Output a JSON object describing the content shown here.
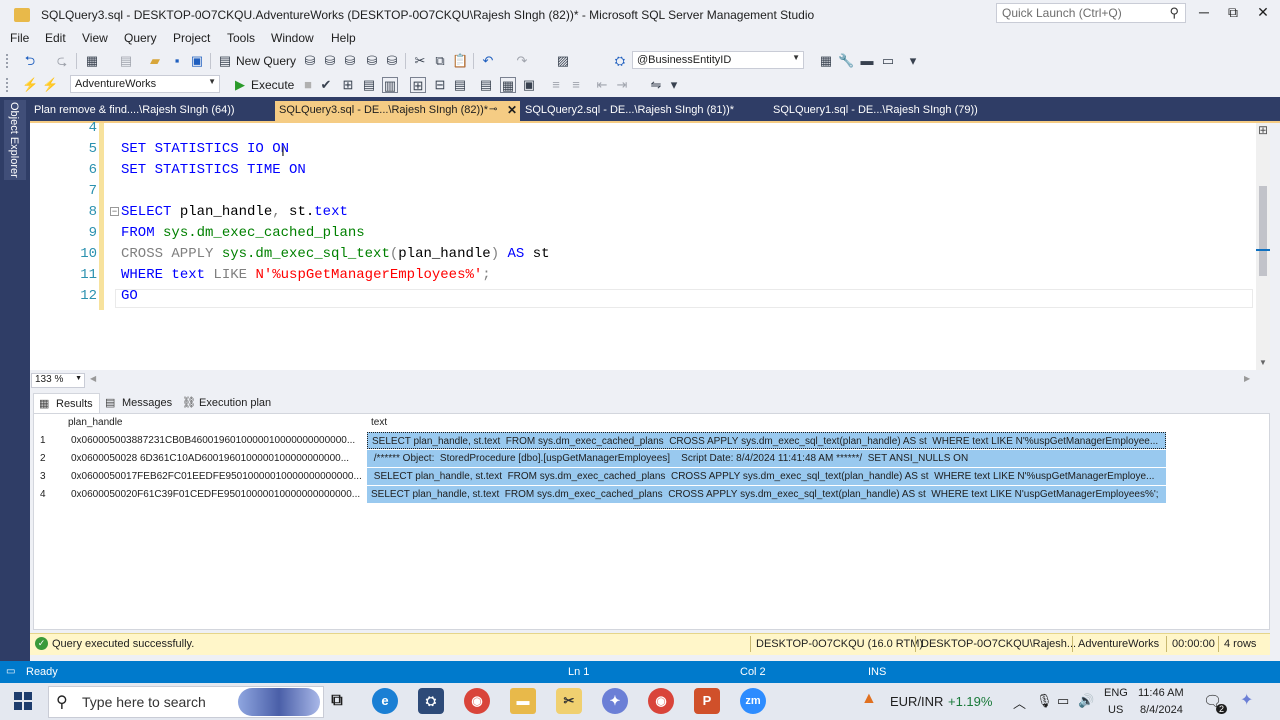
{
  "window": {
    "title": "SQLQuery3.sql - DESKTOP-0O7CKQU.AdventureWorks (DESKTOP-0O7CKQU\\Rajesh SIngh (82))* - Microsoft SQL Server Management Studio",
    "quick_launch_placeholder": "Quick Launch (Ctrl+Q)",
    "minimize": "─",
    "maximize": "⧉",
    "close": "✕"
  },
  "menu": [
    "File",
    "Edit",
    "View",
    "Query",
    "Project",
    "Tools",
    "Window",
    "Help"
  ],
  "toolbar": {
    "new_query_label": "New Query",
    "param_combo_value": "@BusinessEntityID",
    "database_combo_value": "AdventureWorks",
    "execute_label": "Execute"
  },
  "side": {
    "object_explorer_label": "Object Explorer"
  },
  "doc_tabs": [
    {
      "label": "Plan remove & find....\\Rajesh SIngh (64))"
    },
    {
      "label": "SQLQuery3.sql - DE...\\Rajesh SIngh (82))*"
    },
    {
      "label": "SQLQuery2.sql - DE...\\Rajesh SIngh (81))*"
    },
    {
      "label": "SQLQuery1.sql - DE...\\Rajesh SIngh (79))"
    }
  ],
  "editor": {
    "line_numbers": [
      "4",
      "5",
      "6",
      "7",
      "8",
      "9",
      "10",
      "11",
      "12"
    ],
    "code": {
      "l5_a": "SET STATISTICS IO ",
      "l5_b": "ON",
      "l6_a": "SET STATISTICS TIME ",
      "l6_b": "ON",
      "l8_a": "SELECT",
      "l8_b": " plan_handle",
      "l8_c": ",",
      "l8_d": " st.",
      "l8_e": "text",
      "l9_a": "FROM",
      "l9_b": " sys.dm_exec_cached_plans",
      "l10_a": "CROSS APPLY",
      "l10_b": " sys.dm_exec_sql_text",
      "l10_c": "(",
      "l10_d": "plan_handle",
      "l10_e": ")",
      "l10_f": " AS",
      "l10_g": " st",
      "l11_a": "WHERE",
      "l11_b": " text",
      "l11_c": " LIKE",
      "l11_d": " N'%uspGetManagerEmployees%'",
      "l11_e": ";",
      "l12_a": "GO"
    },
    "zoom": "133 %"
  },
  "results": {
    "tabs": [
      "Results",
      "Messages",
      "Execution plan"
    ],
    "columns": [
      "plan_handle",
      "text"
    ],
    "rows": [
      {
        "num": "1",
        "plan_handle": "0x060005003887231CB0B4600196010000010000000000000...",
        "text": "SELECT plan_handle, st.text  FROM sys.dm_exec_cached_plans  CROSS APPLY sys.dm_exec_sql_text(plan_handle) AS st  WHERE text LIKE N'%uspGetManagerEmployee..."
      },
      {
        "num": "2",
        "plan_handle": "0x0600050028 6D361C10AD6001960100000100000000000...",
        "text": " /****** Object:  StoredProcedure [dbo].[uspGetManagerEmployees]    Script Date: 8/4/2024 11:41:48 AM ******/  SET ANSI_NULLS ON"
      },
      {
        "num": "3",
        "plan_handle": "0x0600050017FEB62FC01EEDFE95010000010000000000000...",
        "text": " SELECT plan_handle, st.text  FROM sys.dm_exec_cached_plans  CROSS APPLY sys.dm_exec_sql_text(plan_handle) AS st  WHERE text LIKE N'%uspGetManagerEmploye..."
      },
      {
        "num": "4",
        "plan_handle": "0x0600050020F61C39F01CEDFE95010000010000000000000...",
        "text": "SELECT plan_handle, st.text  FROM sys.dm_exec_cached_plans  CROSS APPLY sys.dm_exec_sql_text(plan_handle) AS st  WHERE text LIKE N'uspGetManagerEmployees%';"
      }
    ]
  },
  "query_status": {
    "message": "Query executed successfully.",
    "server": "DESKTOP-0O7CKQU (16.0 RTM)",
    "user": "DESKTOP-0O7CKQU\\Rajesh...",
    "database": "AdventureWorks",
    "elapsed": "00:00:00",
    "rows": "4 rows"
  },
  "status_bar": {
    "ready": "Ready",
    "ln": "Ln 1",
    "col": "Col 2",
    "ins": "INS"
  },
  "taskbar": {
    "search_placeholder": "Type here to search",
    "currency": "EUR/INR",
    "currency_change": "+1.19%",
    "lang": "ENG",
    "region": "US",
    "time": "11:46 AM",
    "date": "8/4/2024",
    "notification_count": "2"
  },
  "colors": {
    "accent_blue": "#007acc",
    "tab_active": "#f5cc84",
    "tab_strip": "#2f3d66",
    "selection": "#99c9ef",
    "query_status_bg": "#fff6c9"
  }
}
